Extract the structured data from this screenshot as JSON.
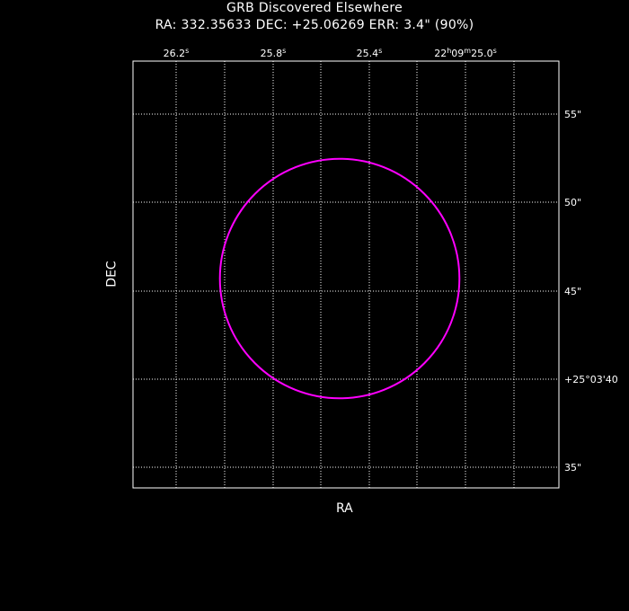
{
  "header": {
    "title": "GRB Discovered Elsewhere",
    "subtitle": "RA: 332.35633  DEC: +25.06269  ERR: 3.4\" (90%)"
  },
  "chart_data": {
    "type": "scatter",
    "title": "GRB Discovered Elsewhere",
    "xlabel": "RA",
    "ylabel": "DEC",
    "grid": true,
    "x_ticks": [
      {
        "label": "26.2",
        "unit": "s"
      },
      {
        "label": "25.8",
        "unit": "s"
      },
      {
        "label": "25.4",
        "unit": "s"
      },
      {
        "label": "22h09m25.0s",
        "prefix": "22",
        "h": "h",
        "mid": "09",
        "m": "m",
        "sec": "25.0",
        "unit": "s"
      }
    ],
    "y_ticks": [
      {
        "label": "55\""
      },
      {
        "label": "50\""
      },
      {
        "label": "45\""
      },
      {
        "label": "+25°03'40"
      },
      {
        "label": "35\""
      }
    ],
    "error_circle": {
      "ra_deg": 332.35633,
      "dec_deg": 25.06269,
      "radius_arcsec": 3.4,
      "confidence": "90%",
      "color": "#ff00ff"
    },
    "colors": {
      "background": "#000000",
      "frame": "#ffffff",
      "grid": "#ffffff",
      "error_circle": "#ff00ff"
    }
  }
}
